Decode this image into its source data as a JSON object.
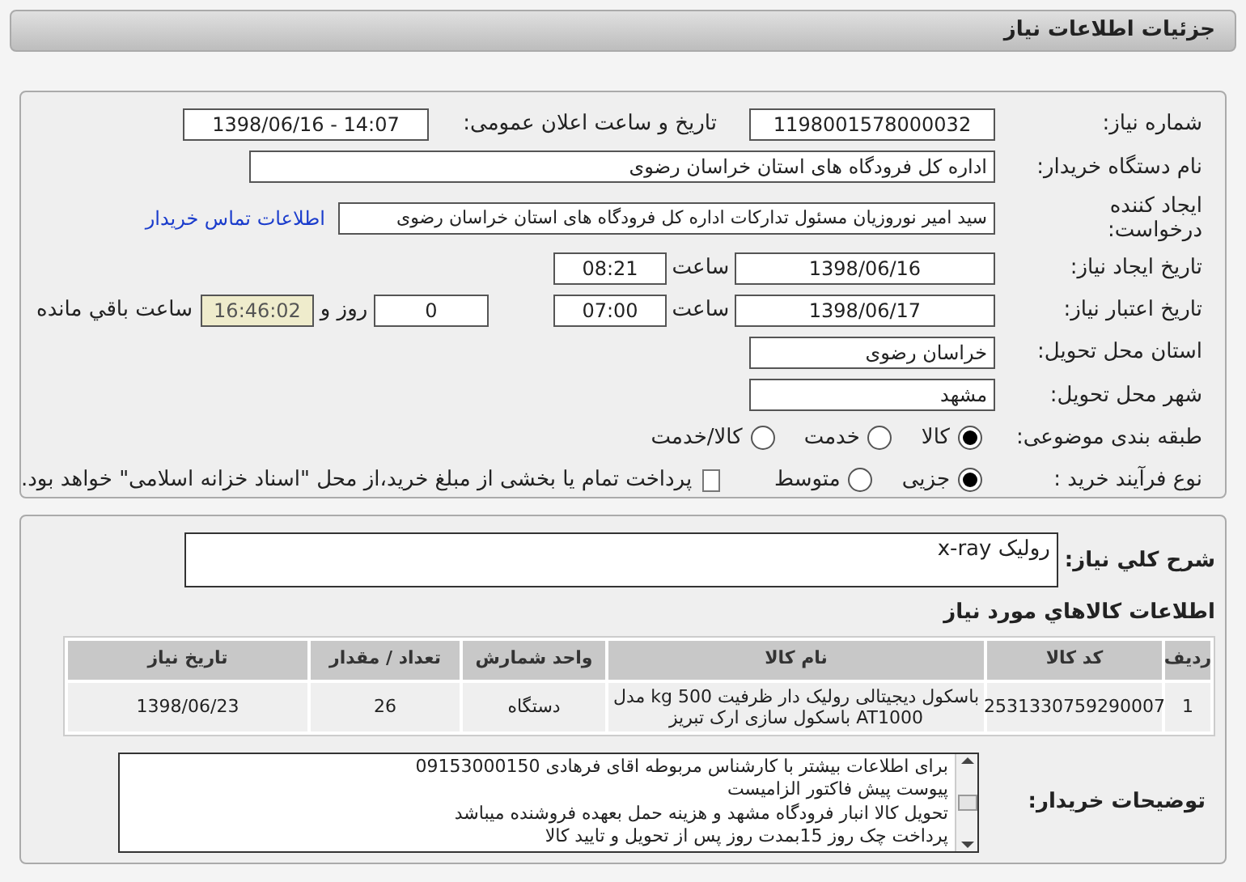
{
  "header": {
    "title": "جزئیات اطلاعات نیاز"
  },
  "details": {
    "need_number": {
      "label": "شماره نیاز:",
      "value": "1198001578000032"
    },
    "announce": {
      "label": "تاریخ و ساعت اعلان عمومی:",
      "value": "1398/06/16 - 14:07"
    },
    "buyer": {
      "label": "نام دستگاه خریدار:",
      "value": "اداره کل فرودگاه های استان خراسان رضوی"
    },
    "requester": {
      "label": "ایجاد کننده درخواست:",
      "value": "سید امیر نوروزیان مسئول تدارکات اداره کل فرودگاه های استان خراسان رضوی",
      "link": "اطلاعات تماس خریدار"
    },
    "created": {
      "label": "تاریخ ایجاد نیاز:",
      "date": "1398/06/16",
      "time_label": "ساعت",
      "time": "08:21"
    },
    "validity": {
      "label": "تاریخ اعتبار نیاز:",
      "date": "1398/06/17",
      "time_label": "ساعت",
      "time": "07:00",
      "days": "0",
      "days_label": "روز و",
      "remaining": "16:46:02",
      "remaining_label": "ساعت باقي مانده"
    },
    "province": {
      "label": "استان محل تحویل:",
      "value": "خراسان رضوی"
    },
    "city": {
      "label": "شهر محل تحویل:",
      "value": "مشهد"
    },
    "category": {
      "label": "طبقه بندی موضوعی:",
      "options": [
        {
          "label": "کالا",
          "selected": true
        },
        {
          "label": "خدمت",
          "selected": false
        },
        {
          "label": "کالا/خدمت",
          "selected": false
        }
      ]
    },
    "process": {
      "label": "نوع فرآیند خرید :",
      "options": [
        {
          "label": "جزیی",
          "selected": true
        },
        {
          "label": "متوسط",
          "selected": false
        }
      ],
      "payment": {
        "checked": false,
        "label": "پرداخت تمام یا بخشی از مبلغ خرید،از محل \"اسناد خزانه اسلامی\" خواهد بود."
      }
    }
  },
  "summary": {
    "label": "شرح کلي نیاز:",
    "value": "رولیک x-ray"
  },
  "items": {
    "title": "اطلاعات کالاهاي مورد نیاز",
    "columns": [
      "ردیف",
      "کد کالا",
      "نام کالا",
      "واحد شمارش",
      "تعداد / مقدار",
      "تاریخ نیاز"
    ],
    "rows": [
      [
        "1",
        "2531330759290007",
        "باسکول دیجیتالی رولیک دار ظرفیت 500 kg مدل AT1000 باسکول سازی ارک تبریز",
        "دستگاه",
        "26",
        "1398/06/23"
      ]
    ]
  },
  "notes": {
    "label": "توضیحات خریدار:",
    "lines": [
      "برای اطلاعات بیشتر با کارشناس مربوطه اقای فرهادی 09153000150",
      "پیوست پیش فاکتور الزامیست",
      "تحویل کالا انبار فرودگاه مشهد و هزینه حمل بعهده فروشنده میباشد",
      "پرداخت چک روز 15بمدت  روز پس از تحویل و تایید کالا"
    ]
  }
}
